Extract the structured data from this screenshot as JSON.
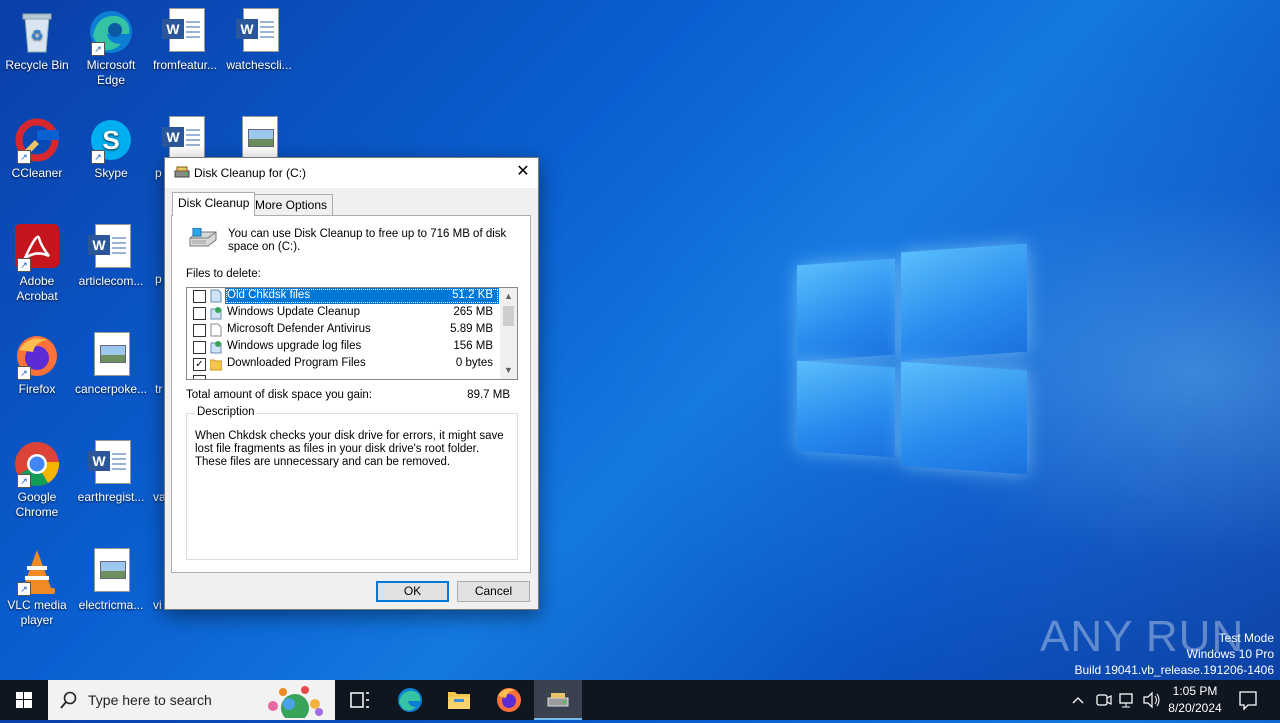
{
  "desktop": {
    "icons": [
      {
        "label": "Recycle Bin"
      },
      {
        "label": "Microsoft Edge"
      },
      {
        "label": "fromfeatur..."
      },
      {
        "label": "watchescli..."
      },
      {
        "label": "CCleaner"
      },
      {
        "label": "Skype"
      },
      {
        "label": "p"
      },
      {
        "label": "Adobe Acrobat"
      },
      {
        "label": "articlecom..."
      },
      {
        "label": "p"
      },
      {
        "label": "Firefox"
      },
      {
        "label": "cancerpoke..."
      },
      {
        "label": "tr"
      },
      {
        "label": "Google Chrome"
      },
      {
        "label": "earthregist..."
      },
      {
        "label": "va"
      },
      {
        "label": "VLC media player"
      },
      {
        "label": "electricma..."
      },
      {
        "label": "vi"
      }
    ]
  },
  "dialog": {
    "title": "Disk Cleanup for  (C:)",
    "tabs": [
      {
        "label": "Disk Cleanup"
      },
      {
        "label": "More Options"
      }
    ],
    "intro": "You can use Disk Cleanup to free up to 716 MB of disk space on  (C:).",
    "files_label": "Files to delete:",
    "files": [
      {
        "name": "Old Chkdsk files",
        "size": "51.2 KB",
        "checked": false,
        "selected": true
      },
      {
        "name": "Windows Update Cleanup",
        "size": "265 MB",
        "checked": false
      },
      {
        "name": "Microsoft Defender Antivirus",
        "size": "5.89 MB",
        "checked": false
      },
      {
        "name": "Windows upgrade log files",
        "size": "156 MB",
        "checked": false
      },
      {
        "name": "Downloaded Program Files",
        "size": "0 bytes",
        "checked": true
      }
    ],
    "total_label": "Total amount of disk space you gain:",
    "total_value": "89.7 MB",
    "description_label": "Description",
    "description": "When Chkdsk checks your disk drive for errors, it might save lost file fragments as files in your disk drive's root folder. These files are unnecessary and can be removed.",
    "ok_label": "OK",
    "cancel_label": "Cancel",
    "close_glyph": "✕"
  },
  "watermark": {
    "brand": "ANY RUN",
    "mode": "Test Mode",
    "edition": "Windows 10 Pro",
    "build": "Build 19041.vb_release.191206-1406"
  },
  "taskbar": {
    "search_placeholder": "Type here to search",
    "clock_time": "1:05 PM",
    "clock_date": "8/20/2024",
    "check_glyph": "✓"
  },
  "colors": {
    "accent": "#0078d7",
    "desktop": "#0a5fd1",
    "taskbar": "#0f1620"
  }
}
